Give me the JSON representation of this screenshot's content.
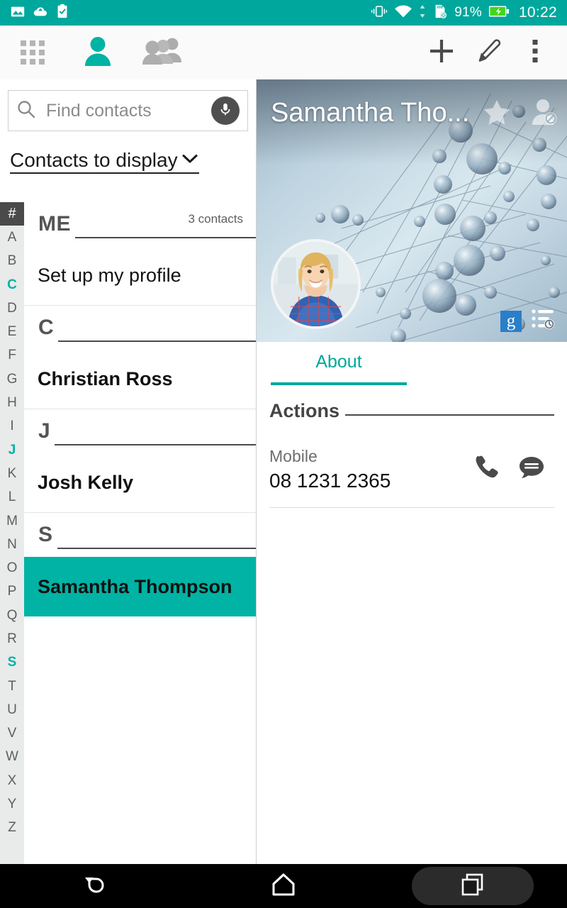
{
  "status_bar": {
    "left_icons": [
      "photo-icon",
      "cloud-icon",
      "task-checklist-icon"
    ],
    "right_icons": [
      "vibrate-icon",
      "wifi-icon",
      "sd-card-removed-icon"
    ],
    "battery_percent": "91%",
    "battery_state": "charging",
    "clock": "10:22",
    "background_color": "#00a79d"
  },
  "app_bar": {
    "tabs": [
      {
        "name": "dialpad-tab",
        "icon": "grid-icon",
        "active": false
      },
      {
        "name": "contacts-tab",
        "icon": "person-icon",
        "active": true
      },
      {
        "name": "groups-tab",
        "icon": "people-icon",
        "active": false
      }
    ],
    "actions": [
      {
        "name": "add-contact-button",
        "icon": "plus-icon"
      },
      {
        "name": "edit-button",
        "icon": "pencil-icon"
      },
      {
        "name": "overflow-menu-button",
        "icon": "more-vertical-icon"
      }
    ],
    "accent_color": "#00b3a4"
  },
  "search": {
    "placeholder": "Find contacts",
    "value": "",
    "mic_icon": "microphone-icon",
    "search_icon": "search-icon"
  },
  "filter": {
    "label": "Contacts to display",
    "chevron": "chevron-down-icon"
  },
  "alpha_index": {
    "letters": [
      "#",
      "A",
      "B",
      "C",
      "D",
      "E",
      "F",
      "G",
      "H",
      "I",
      "J",
      "K",
      "L",
      "M",
      "N",
      "O",
      "P",
      "Q",
      "R",
      "S",
      "T",
      "U",
      "V",
      "W",
      "X",
      "Y",
      "Z"
    ],
    "active_letters": [
      "C",
      "J",
      "S"
    ],
    "selected": "#"
  },
  "contacts_list": {
    "rows": [
      {
        "type": "header",
        "letter": "ME",
        "count": "3 contacts"
      },
      {
        "type": "item",
        "name": "Set up my profile",
        "bold": false,
        "selected": false
      },
      {
        "type": "header",
        "letter": "C",
        "count": ""
      },
      {
        "type": "item",
        "name": "Christian Ross",
        "bold": true,
        "selected": false
      },
      {
        "type": "header",
        "letter": "J",
        "count": ""
      },
      {
        "type": "item",
        "name": "Josh Kelly",
        "bold": true,
        "selected": false
      },
      {
        "type": "header",
        "letter": "S",
        "count": ""
      },
      {
        "type": "item",
        "name": "Samantha Thompson",
        "bold": true,
        "selected": true
      }
    ]
  },
  "detail": {
    "cover_name": "Samantha Tho...",
    "cover_icons": [
      "favorite-star-icon",
      "block-contact-icon"
    ],
    "cover_badges": [
      "google-account-icon",
      "history-list-icon"
    ],
    "avatar": "contact-photo",
    "tabs": [
      {
        "label": "About",
        "active": true
      }
    ],
    "sections": [
      {
        "title": "Actions",
        "entries": [
          {
            "label": "Mobile",
            "value": "08 1231 2365",
            "actions": [
              "call-icon",
              "message-icon"
            ]
          }
        ]
      }
    ]
  },
  "nav_bar": {
    "buttons": [
      {
        "name": "back-button",
        "icon": "back-arrow-icon"
      },
      {
        "name": "home-button",
        "icon": "home-icon"
      },
      {
        "name": "recents-button",
        "icon": "recent-apps-icon"
      }
    ]
  }
}
